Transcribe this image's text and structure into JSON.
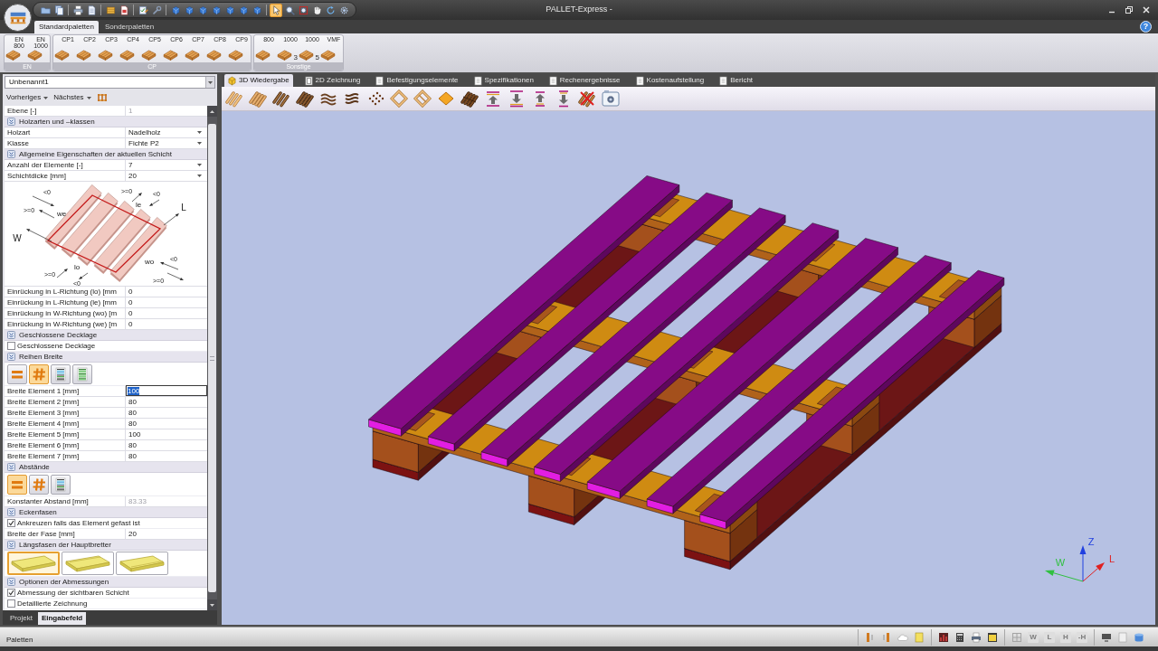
{
  "window": {
    "title": "PALLET-Express -",
    "help": "?"
  },
  "quick_access": [
    {
      "selected": false
    },
    {
      "selected": false
    },
    {
      "selected": false
    },
    {
      "selected": false
    },
    {
      "selected": false
    },
    {
      "selected": false
    },
    {
      "selected": false
    },
    {
      "selected": false
    },
    {
      "selected": false
    },
    {
      "selected": false
    },
    {
      "selected": false
    },
    {
      "selected": false
    },
    {
      "selected": false
    },
    {
      "selected": false
    },
    {
      "selected": false
    },
    {
      "selected": true
    },
    {
      "selected": false
    },
    {
      "selected": false
    },
    {
      "selected": false
    },
    {
      "selected": false
    },
    {
      "selected": false
    }
  ],
  "ribbon": {
    "tabs": [
      {
        "label": "Standardpaletten",
        "selected": true
      },
      {
        "label": "Sonderpaletten",
        "selected": false
      }
    ],
    "groups": [
      {
        "title": "EN",
        "buttons": [
          {
            "label": "EN",
            "sub_label": "800"
          },
          {
            "label": "EN",
            "sub_label": "1000"
          }
        ]
      },
      {
        "title": "CP",
        "buttons": [
          {
            "label": "CP1"
          },
          {
            "label": "CP2"
          },
          {
            "label": "CP3"
          },
          {
            "label": "CP4"
          },
          {
            "label": "CP5"
          },
          {
            "label": "CP6"
          },
          {
            "label": "CP7"
          },
          {
            "label": "CP8"
          },
          {
            "label": "CP9"
          }
        ]
      },
      {
        "title": "Sonstige",
        "buttons": [
          {
            "label": "800"
          },
          {
            "label": "1000",
            "badge": "3"
          },
          {
            "label": "1000",
            "badge": "5"
          },
          {
            "label": "VMF"
          }
        ]
      }
    ]
  },
  "left_panel": {
    "document": "Unbenannt1",
    "nav": [
      "Vorheriges",
      "Nächstes"
    ],
    "properties": [
      {
        "kind": "field",
        "label": "Ebene [-]",
        "value": "1",
        "readonly": true,
        "dropdown": false,
        "editing": false
      },
      {
        "kind": "section",
        "title": "Holzarten und –klassen",
        "expanded": true
      },
      {
        "kind": "field",
        "label": "Holzart",
        "value": "Nadelholz",
        "readonly": false,
        "dropdown": true,
        "editing": false
      },
      {
        "kind": "field",
        "label": "Klasse",
        "value": "Fichte P2",
        "readonly": false,
        "dropdown": true,
        "editing": false
      },
      {
        "kind": "section",
        "title": "Allgemeine Eigenschaften der aktuellen Schicht",
        "expanded": true
      },
      {
        "kind": "field",
        "label": "Anzahl der Elemente [-]",
        "value": "7",
        "readonly": false,
        "dropdown": true,
        "editing": false
      },
      {
        "kind": "field",
        "label": "Schichtdicke [mm]",
        "value": "20",
        "readonly": false,
        "dropdown": true,
        "editing": false
      },
      {
        "kind": "diagram",
        "labels": [
          "<0",
          ">=0",
          "we",
          ">=0",
          "<0",
          "le",
          "L",
          "W",
          "wo",
          "<0",
          ">=0",
          ">=0",
          "lo",
          "<0"
        ]
      },
      {
        "kind": "field",
        "label": "Einrückung in L-Richtung (lo) [mm",
        "value": "0",
        "readonly": false,
        "dropdown": false,
        "editing": false
      },
      {
        "kind": "field",
        "label": "Einrückung in L-Richtung (le) [mm",
        "value": "0",
        "readonly": false,
        "dropdown": false,
        "editing": false
      },
      {
        "kind": "field",
        "label": "Einrückung in W-Richtung (wo) [m",
        "value": "0",
        "readonly": false,
        "dropdown": false,
        "editing": false
      },
      {
        "kind": "field",
        "label": "Einrückung in W-Richtung (we) [m",
        "value": "0",
        "readonly": false,
        "dropdown": false,
        "editing": false
      },
      {
        "kind": "section",
        "title": "Geschlossene Decklage",
        "expanded": true
      },
      {
        "kind": "checkbox",
        "label": "Geschlossene Decklage",
        "checked": false
      },
      {
        "kind": "section",
        "title": "Reihen Breite",
        "expanded": true
      },
      {
        "kind": "options",
        "options": [
          {
            "selected": false
          },
          {
            "selected": true
          },
          {
            "selected": false
          },
          {
            "selected": false
          }
        ]
      },
      {
        "kind": "field",
        "label": "Breite Element 1 [mm]",
        "value": "100",
        "readonly": false,
        "dropdown": false,
        "editing": true
      },
      {
        "kind": "field",
        "label": "Breite Element 2 [mm]",
        "value": "80",
        "readonly": false,
        "dropdown": false,
        "editing": false
      },
      {
        "kind": "field",
        "label": "Breite Element 3 [mm]",
        "value": "80",
        "readonly": false,
        "dropdown": false,
        "editing": false
      },
      {
        "kind": "field",
        "label": "Breite Element 4 [mm]",
        "value": "80",
        "readonly": false,
        "dropdown": false,
        "editing": false
      },
      {
        "kind": "field",
        "label": "Breite Element 5 [mm]",
        "value": "100",
        "readonly": false,
        "dropdown": false,
        "editing": false
      },
      {
        "kind": "field",
        "label": "Breite Element 6 [mm]",
        "value": "80",
        "readonly": false,
        "dropdown": false,
        "editing": false
      },
      {
        "kind": "field",
        "label": "Breite Element 7 [mm]",
        "value": "80",
        "readonly": false,
        "dropdown": false,
        "editing": false
      },
      {
        "kind": "section",
        "title": "Abstände",
        "expanded": true
      },
      {
        "kind": "options",
        "options": [
          {
            "selected": true
          },
          {
            "selected": false
          },
          {
            "selected": false
          }
        ]
      },
      {
        "kind": "field",
        "label": "Konstanter Abstand [mm]",
        "value": "83.33",
        "readonly": true,
        "dropdown": false,
        "editing": false
      },
      {
        "kind": "section",
        "title": "Eckenfasen",
        "expanded": true
      },
      {
        "kind": "checkbox",
        "label": "Ankreuzen falls das Element gefast ist",
        "checked": true
      },
      {
        "kind": "field",
        "label": "Breite der Fase [mm]",
        "value": "20",
        "readonly": false,
        "dropdown": false,
        "editing": false
      },
      {
        "kind": "section",
        "title": "Längsfasen der Hauptbretter",
        "expanded": true
      },
      {
        "kind": "images",
        "options": [
          {
            "selected": true
          },
          {
            "selected": false
          },
          {
            "selected": false
          }
        ]
      },
      {
        "kind": "section",
        "title": "Optionen der Abmessungen",
        "expanded": true
      },
      {
        "kind": "checkbox",
        "label": "Abmessung der sichtbaren Schicht",
        "checked": true
      },
      {
        "kind": "checkbox",
        "label": "Detaillierte Zeichnung",
        "checked": false
      }
    ],
    "tabs": [
      {
        "label": "Projekt",
        "selected": false
      },
      {
        "label": "Eingabefeld",
        "selected": true
      }
    ]
  },
  "main": {
    "tabs": [
      {
        "label": "3D Wiedergabe",
        "selected": true
      },
      {
        "label": "2D Zeichnung",
        "selected": false
      },
      {
        "label": "Befestigungselemente",
        "selected": false
      },
      {
        "label": "Spezifikationen",
        "selected": false
      },
      {
        "label": "Rechenergebnisse",
        "selected": false
      },
      {
        "label": "Kostenaufstellung",
        "selected": false
      },
      {
        "label": "Bericht",
        "selected": false
      }
    ],
    "viewport": {
      "axes": [
        {
          "label": "Z",
          "color": "#2040e0"
        },
        {
          "label": "W",
          "color": "#30c040"
        },
        {
          "label": "L",
          "color": "#e02020"
        }
      ]
    }
  },
  "status_bar": {
    "text": "Paletten",
    "view_buttons": {
      "disabled": true,
      "labels": [
        "W",
        "L",
        "H",
        "-H"
      ]
    }
  }
}
